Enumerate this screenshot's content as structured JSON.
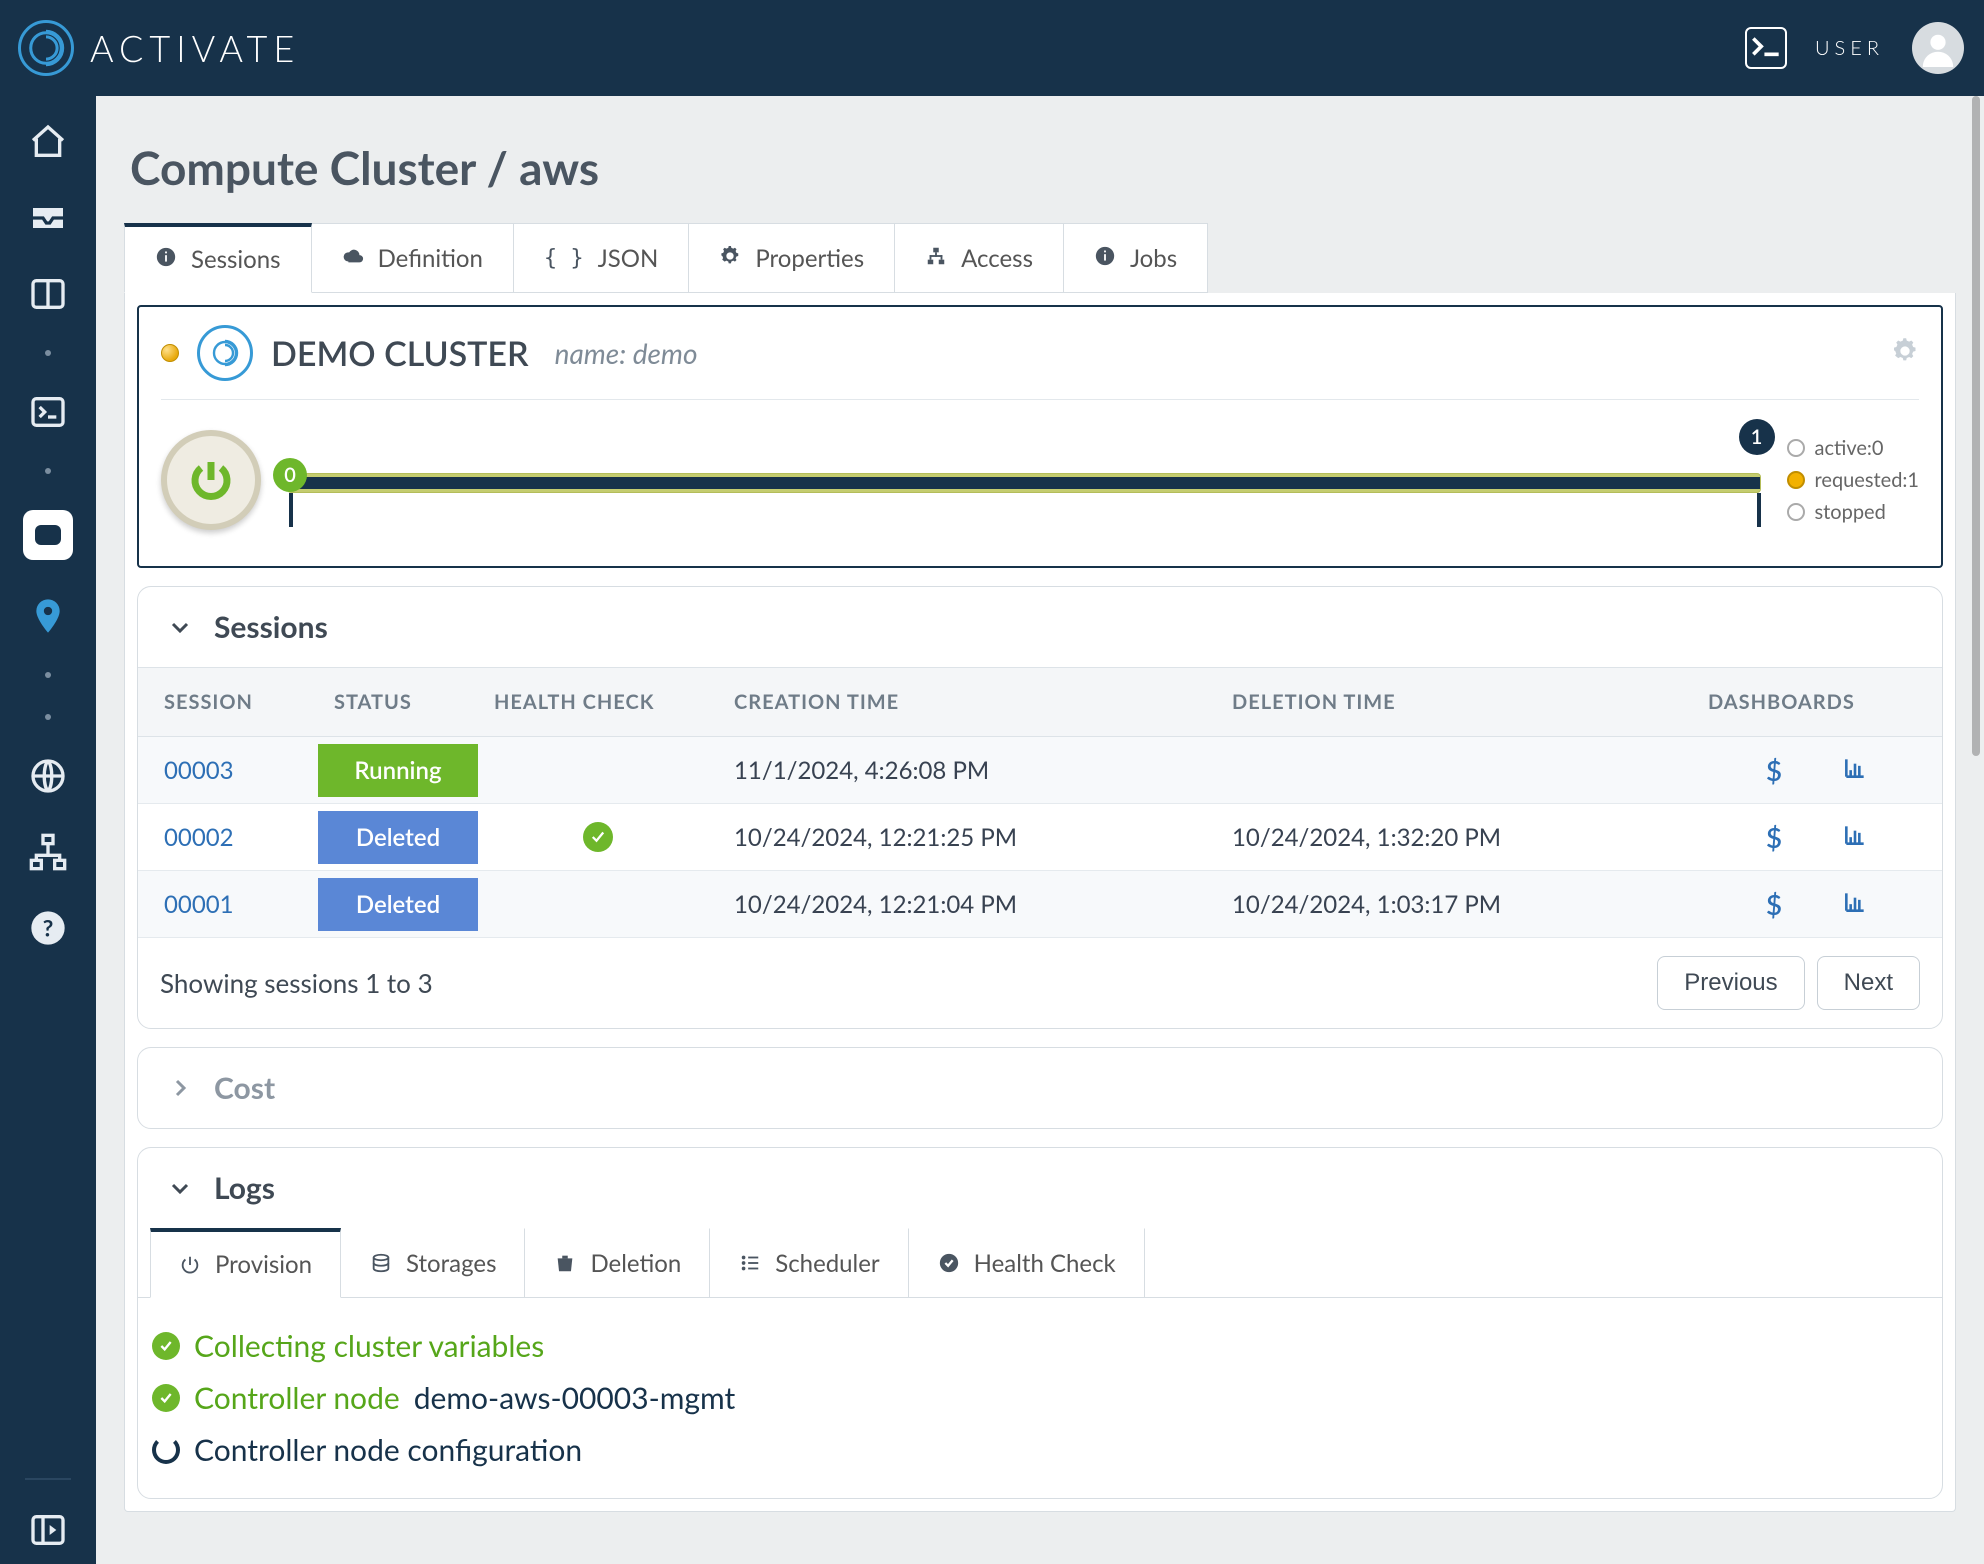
{
  "header": {
    "brand": "ACTIVATE",
    "user_label": "USER"
  },
  "page": {
    "title": "Compute Cluster / aws"
  },
  "tabs": {
    "sessions": "Sessions",
    "definition": "Definition",
    "json": "JSON",
    "properties": "Properties",
    "access": "Access",
    "jobs": "Jobs"
  },
  "hero": {
    "title": "DEMO CLUSTER",
    "subtitle": "name: demo",
    "slider_min": "0",
    "slider_val": "1",
    "legend": {
      "active": "active:0",
      "requested": "requested:1",
      "stopped": "stopped"
    }
  },
  "sessions_card": {
    "title": "Sessions",
    "headers": {
      "session": "SESSION",
      "status": "STATUS",
      "health": "HEALTH CHECK",
      "created": "CREATION TIME",
      "deleted": "DELETION TIME",
      "dash": "DASHBOARDS"
    },
    "rows": [
      {
        "id": "00003",
        "status": "Running",
        "status_class": "chip-running",
        "health": "",
        "created": "11/1/2024, 4:26:08 PM",
        "deleted": ""
      },
      {
        "id": "00002",
        "status": "Deleted",
        "status_class": "chip-deleted",
        "health": "ok",
        "created": "10/24/2024, 12:21:25 PM",
        "deleted": "10/24/2024, 1:32:20 PM"
      },
      {
        "id": "00001",
        "status": "Deleted",
        "status_class": "chip-deleted",
        "health": "",
        "created": "10/24/2024, 12:21:04 PM",
        "deleted": "10/24/2024, 1:03:17 PM"
      }
    ],
    "footer": "Showing sessions 1 to 3",
    "prev": "Previous",
    "next": "Next"
  },
  "cost_card": {
    "title": "Cost"
  },
  "logs_card": {
    "title": "Logs",
    "tabs": {
      "provision": "Provision",
      "storages": "Storages",
      "deletion": "Deletion",
      "scheduler": "Scheduler",
      "health": "Health Check"
    },
    "lines": [
      {
        "state": "ok",
        "msg": "Collecting cluster variables",
        "suffix": ""
      },
      {
        "state": "ok",
        "msg": "Controller node ",
        "suffix": "demo-aws-00003-mgmt"
      },
      {
        "state": "spin",
        "msg": "Controller node configuration",
        "suffix": ""
      }
    ]
  }
}
